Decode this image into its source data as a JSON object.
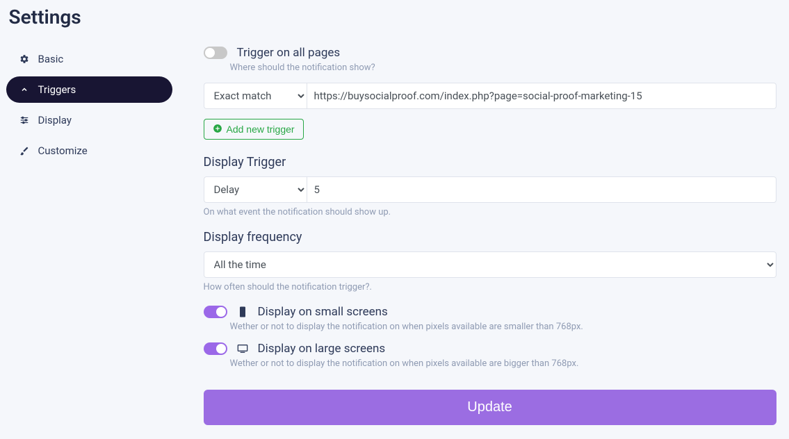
{
  "page_title": "Settings",
  "sidebar": {
    "items": [
      {
        "label": "Basic"
      },
      {
        "label": "Triggers"
      },
      {
        "label": "Display"
      },
      {
        "label": "Customize"
      }
    ]
  },
  "trigger_all_pages": {
    "label": "Trigger on all pages",
    "hint": "Where should the notification show?"
  },
  "trigger_rule": {
    "match_type": "Exact match",
    "url": "https://buysocialproof.com/index.php?page=social-proof-marketing-15"
  },
  "add_trigger_label": "Add new trigger",
  "display_trigger": {
    "title": "Display Trigger",
    "type": "Delay",
    "value": "5",
    "hint": "On what event the notification should show up."
  },
  "display_frequency": {
    "title": "Display frequency",
    "value": "All the time",
    "hint": "How often should the notification trigger?."
  },
  "small_screens": {
    "label": "Display on small screens",
    "hint": "Wether or not to display the notification on when pixels available are smaller than 768px."
  },
  "large_screens": {
    "label": "Display on large screens",
    "hint": "Wether or not to display the notification on when pixels available are bigger than 768px."
  },
  "update_label": "Update"
}
